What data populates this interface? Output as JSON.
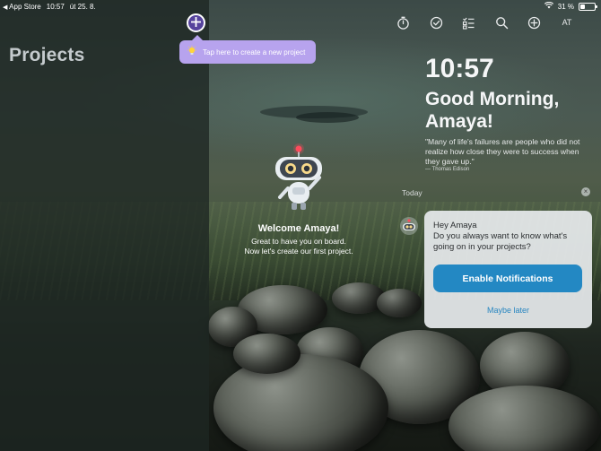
{
  "status_bar": {
    "back_app": "App Store",
    "time": "10:57",
    "date": "út 25. 8.",
    "battery": "31 %",
    "battery_level": 0.31
  },
  "left_panel": {
    "title": "Projects"
  },
  "tooltip": {
    "text": "Tap here to create a new project",
    "icon": "lightbulb-icon"
  },
  "toolbar": {
    "icons": [
      "timer-icon",
      "check-circle-icon",
      "checklist-icon",
      "search-icon",
      "add-circle-icon"
    ],
    "avatar_initials": "AT"
  },
  "welcome": {
    "title": "Welcome Amaya!",
    "line1": "Great to have you on board.",
    "line2": "Now let's create our first project."
  },
  "dashboard": {
    "clock": "10:57",
    "greeting_line1": "Good Morning,",
    "greeting_line2": "Amaya!",
    "quote": "\"Many of life's failures are people who did not realize how close they were to success when they gave up.\"",
    "quote_author": "— Thomas Edison",
    "today_label": "Today"
  },
  "notification": {
    "title": "Hey Amaya",
    "body": "Do you always want to know what's going on in your projects?",
    "enable_label": "Enable Notifications",
    "later_label": "Maybe later"
  },
  "colors": {
    "accent_purple": "#56439d",
    "tooltip_bg": "#b7a3ee",
    "primary_blue": "#2388c3"
  }
}
